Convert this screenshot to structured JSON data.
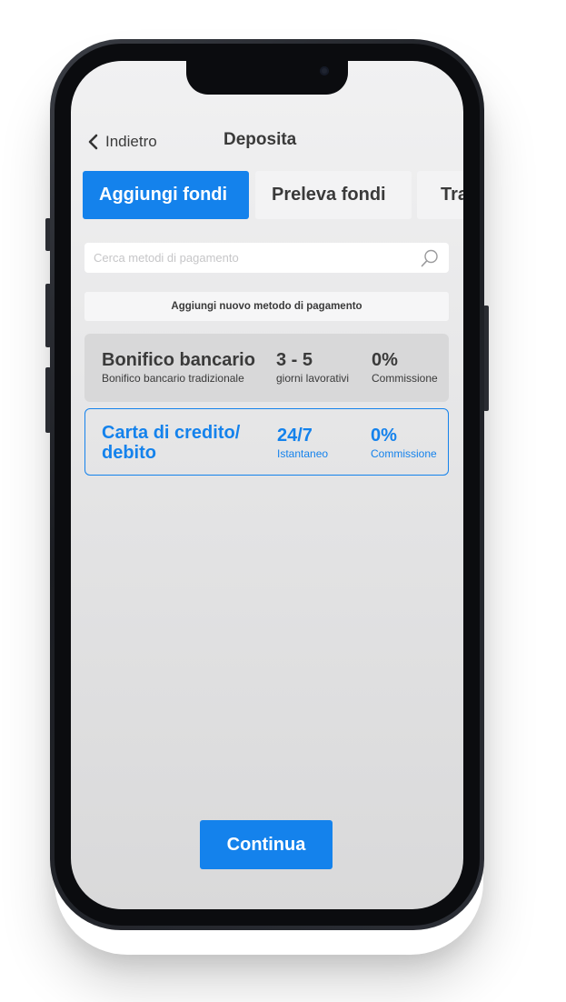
{
  "header": {
    "back_label": "Indietro",
    "title": "Deposita"
  },
  "tabs": [
    {
      "label": "Aggiungi fondi",
      "active": true
    },
    {
      "label": "Preleva fondi",
      "active": false
    },
    {
      "label": "Trasferisci",
      "active": false
    }
  ],
  "search": {
    "placeholder": "Cerca metodi di pagamento",
    "icon": "search-icon"
  },
  "add_method_label": "Aggiungi nuovo metodo di pagamento",
  "methods": [
    {
      "name": "Bonifico bancario",
      "description": "Bonifico bancario tradizionale",
      "timing": "3 - 5",
      "timing_label": "giorni lavorativi",
      "fee": "0%",
      "fee_label": "Commissione",
      "selected": false
    },
    {
      "name_line1": "Carta di credito/",
      "name_line2": "debito",
      "timing": "24/7",
      "timing_label": "Istantaneo",
      "fee": "0%",
      "fee_label": "Commissione",
      "selected": true
    }
  ],
  "continue_label": "Continua",
  "colors": {
    "accent": "#1482ec",
    "text": "#3a3a3a"
  }
}
